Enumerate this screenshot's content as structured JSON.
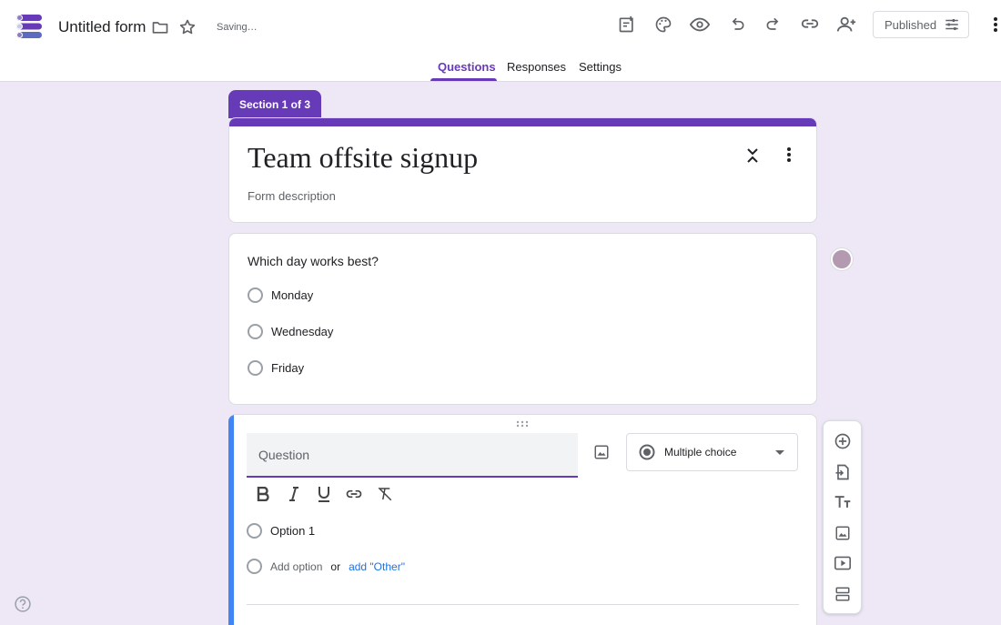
{
  "app": {
    "title": "Untitled form",
    "status": "Saving…"
  },
  "header": {
    "published_label": "Published"
  },
  "tabs": [
    {
      "label": "Questions"
    },
    {
      "label": "Responses"
    },
    {
      "label": "Settings"
    }
  ],
  "section": {
    "label": "Section 1 of 3"
  },
  "form": {
    "title": "Team offsite signup",
    "description_placeholder": "Form description"
  },
  "question1": {
    "text": "Which day works best?",
    "options": [
      "Monday",
      "Wednesday",
      "Friday"
    ]
  },
  "question2": {
    "placeholder": "Question",
    "type": "Multiple choice",
    "option1": "Option 1",
    "add_option": "Add option",
    "or": "or",
    "add_other": "add \"Other\""
  },
  "colors": {
    "accent": "#673ab7",
    "active_bar": "#4285f4",
    "background": "#ede7f6"
  },
  "icons": [
    "logo-icon",
    "folder-icon",
    "star-icon",
    "customize-icon",
    "palette-icon",
    "preview-eye-icon",
    "undo-icon",
    "redo-icon",
    "link-icon",
    "add-collaborator-icon",
    "settings-sliders-icon",
    "more-vert-icon",
    "collapse-icon",
    "image-icon",
    "bold-icon",
    "italic-icon",
    "underline-icon",
    "link-icon",
    "clear-format-icon",
    "add-question-icon",
    "import-questions-icon",
    "add-title-icon",
    "add-image-icon",
    "add-video-icon",
    "add-section-icon",
    "help-icon"
  ]
}
